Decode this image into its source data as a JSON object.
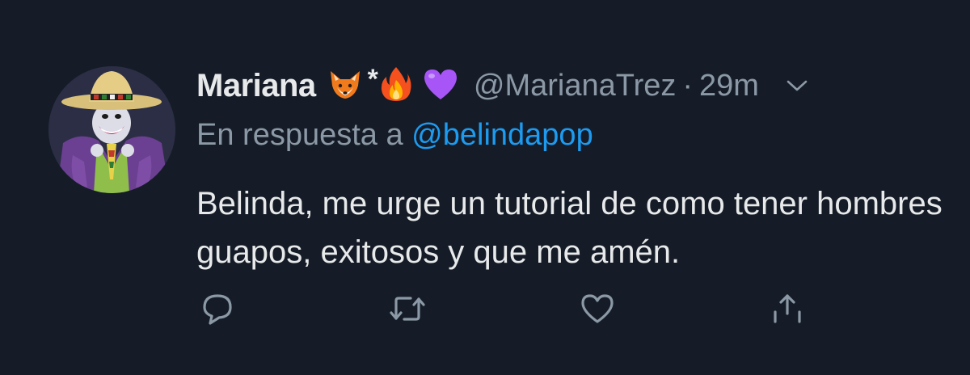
{
  "tweet": {
    "display_name": "Mariana",
    "name_emojis": [
      "fox-emoji",
      "asterisk",
      "fire-emoji",
      "purple-heart-emoji"
    ],
    "star": "*",
    "handle": "@MarianaTrez",
    "separator": "·",
    "time": "29m",
    "reply_prefix": "En respuesta a ",
    "reply_to": "@belindapop",
    "text": "Belinda, me urge un tutorial de como tener hombres guapos, exitosos y que me amén."
  },
  "actions": {
    "reply_icon": "reply-icon",
    "retweet_icon": "retweet-icon",
    "like_icon": "heart-icon",
    "share_icon": "share-icon"
  },
  "colors": {
    "background": "#151c27",
    "text": "#e7e9ea",
    "secondary": "#8b98a5",
    "link": "#1d9bf0"
  }
}
